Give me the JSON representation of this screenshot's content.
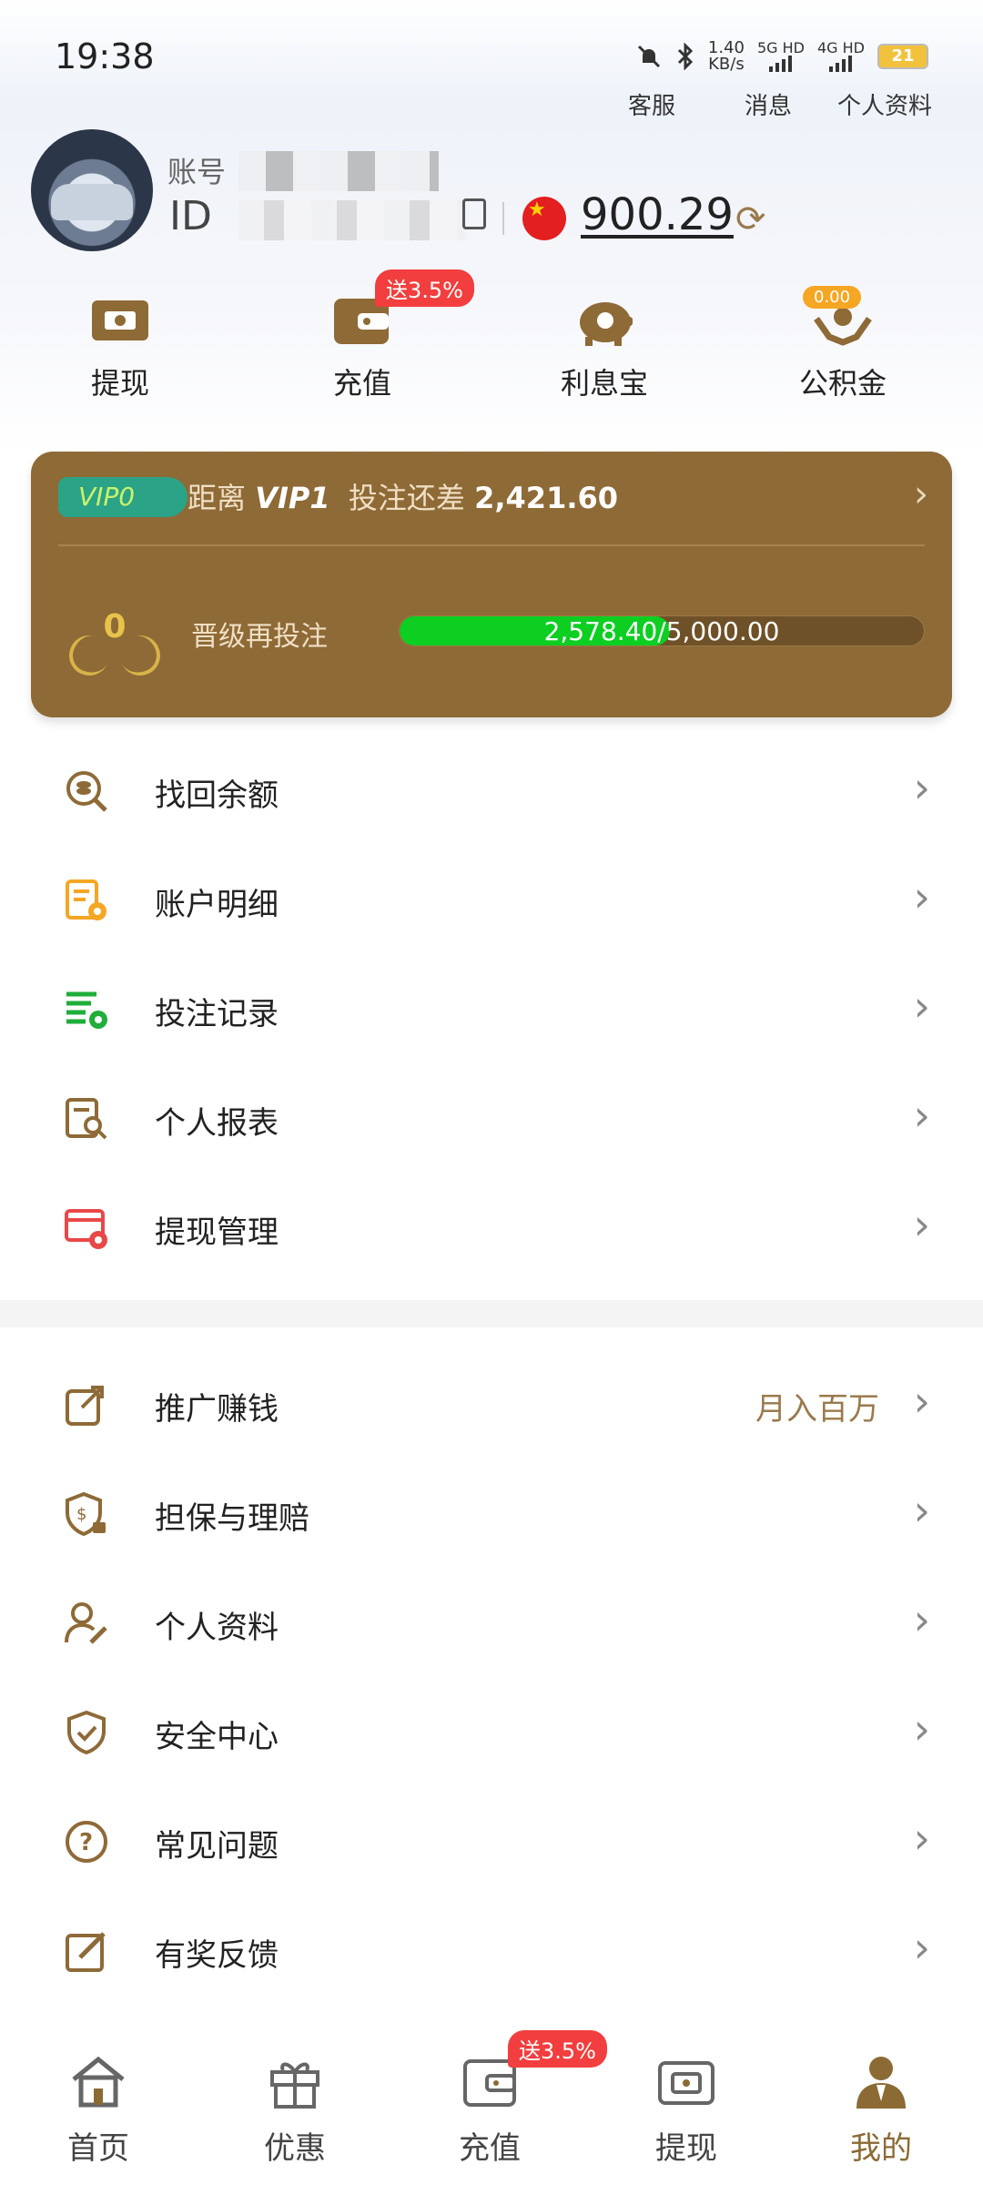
{
  "status": {
    "time": "19:38",
    "speed": "1.40",
    "speed_unit": "KB/s",
    "net1": "5G HD",
    "net2": "4G HD",
    "battery": "21"
  },
  "top_links": {
    "service": "客服",
    "messages": "消息",
    "profile": "个人资料"
  },
  "profile": {
    "account_label": "账号",
    "id_label": "ID",
    "balance": "900.29"
  },
  "quick_actions": [
    {
      "label": "提现",
      "icon": "ticket-icon"
    },
    {
      "label": "充值",
      "icon": "wallet-icon",
      "badge": "送3.5%"
    },
    {
      "label": "利息宝",
      "icon": "piggy-bank-icon"
    },
    {
      "label": "公积金",
      "icon": "hands-coin-icon",
      "badge": "0.00"
    }
  ],
  "vip": {
    "badge": "VIP0",
    "distance_prefix": "距离",
    "next_level": "VIP1",
    "bet_gap_label": "投注还差",
    "bet_gap_amount": "2,421.60",
    "level_number": "0",
    "upgrade_label": "晋级再投注",
    "progress_text": "2,578.40/5,000.00",
    "progress_fraction": 0.5157
  },
  "menu_group_1": [
    {
      "label": "找回余额",
      "icon": "coin-search-icon"
    },
    {
      "label": "账户明细",
      "icon": "account-detail-icon"
    },
    {
      "label": "投注记录",
      "icon": "bet-record-icon"
    },
    {
      "label": "个人报表",
      "icon": "report-search-icon"
    },
    {
      "label": "提现管理",
      "icon": "withdraw-settings-icon"
    }
  ],
  "menu_group_2": [
    {
      "label": "推广赚钱",
      "icon": "share-icon",
      "extra": "月入百万"
    },
    {
      "label": "担保与理赔",
      "icon": "shield-dollar-icon"
    },
    {
      "label": "个人资料",
      "icon": "user-edit-icon"
    },
    {
      "label": "安全中心",
      "icon": "shield-check-icon"
    },
    {
      "label": "常见问题",
      "icon": "question-icon"
    },
    {
      "label": "有奖反馈",
      "icon": "edit-icon"
    }
  ],
  "tabbar": [
    {
      "label": "首页",
      "icon": "home-icon"
    },
    {
      "label": "优惠",
      "icon": "gift-icon"
    },
    {
      "label": "充值",
      "icon": "wallet-icon",
      "badge": "送3.5%"
    },
    {
      "label": "提现",
      "icon": "ticket-icon"
    },
    {
      "label": "我的",
      "icon": "person-icon",
      "active": true
    }
  ],
  "colors": {
    "brand_brown": "#8e6a37",
    "accent_brown": "#9a7a4c",
    "progress_green": "#0ccf22",
    "badge_red": "#f23e3e",
    "badge_orange": "#f5a623"
  }
}
